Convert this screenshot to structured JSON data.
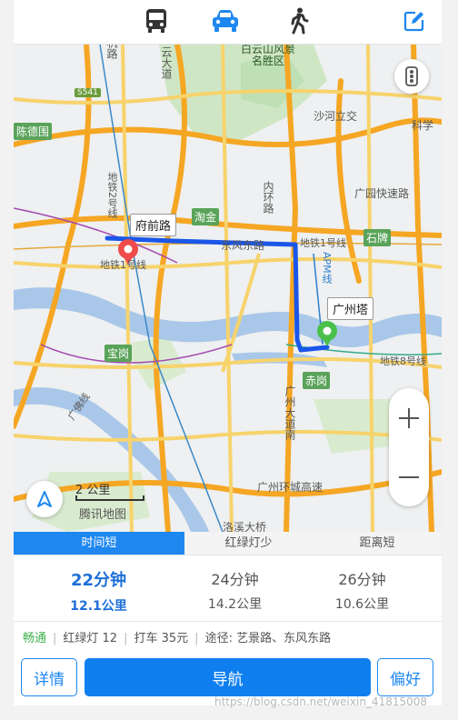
{
  "modes": [
    {
      "icon": "bus-icon",
      "color": "#333333"
    },
    {
      "icon": "car-icon",
      "color": "#1e87f0"
    },
    {
      "icon": "walk-icon",
      "color": "#333333"
    }
  ],
  "map": {
    "labels": {
      "baiyun": "白云山风景",
      "mingsheng": "名胜区",
      "yunjing": "云大道",
      "xiaolu": "机路",
      "s541": "S541",
      "chende": "陈德围",
      "shaheding": "沙河立交",
      "kexue": "科学",
      "guangyuan": "广园快速路",
      "taojin": "淘金",
      "shipai": "石牌",
      "fuqian": "府前路",
      "dongfeng": "东风东路",
      "metro1a": "地铁1号线",
      "metro1b": "地铁1号线",
      "metro2": "地铁2号线",
      "metro8": "地铁8号线",
      "apm": "APM线",
      "guangzhouta": "广州塔",
      "baogang": "宝岗",
      "chigang": "赤岗",
      "guangfo": "广佛线",
      "neihuan": "内环路",
      "dadaonan": "广州大道南",
      "huancheng": "广州环城高速",
      "luojun": "洛溪大桥",
      "scale": "2 公里",
      "tencent": "腾讯地图"
    },
    "route_color": "#1a56e8"
  },
  "tabs": [
    "时间短",
    "红绿灯少",
    "距离短"
  ],
  "options": [
    {
      "time": "22分钟",
      "distance": "12.1公里"
    },
    {
      "time": "24分钟",
      "distance": "14.2公里"
    },
    {
      "time": "26分钟",
      "distance": "10.6公里"
    }
  ],
  "info": {
    "traffic": "畅通",
    "lights": "红绿灯 12",
    "taxi": "打车 35元",
    "via": "途径: 艺景路、东风东路"
  },
  "buttons": {
    "detail": "详情",
    "navigate": "导航",
    "prefer": "偏好"
  },
  "watermark": "https://blog.csdn.net/weixin_41815008"
}
